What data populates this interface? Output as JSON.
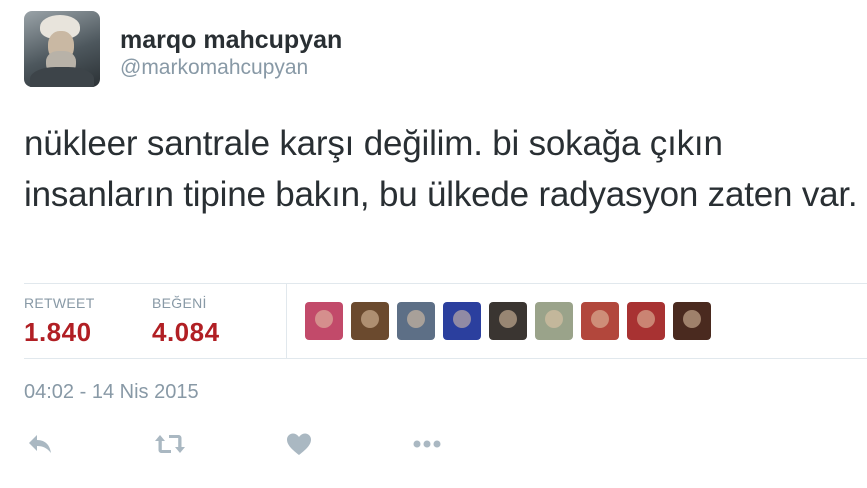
{
  "user": {
    "display_name": "marqo mahcupyan",
    "handle": "@markomahcupyan"
  },
  "tweet": {
    "text": "nükleer santrale karşı değilim. bi sokağa çıkın insanların tipine bakın, bu ülkede radyasyon zaten var.",
    "timestamp": "04:02 - 14 Nis 2015"
  },
  "stats": {
    "retweet_label": "RETWEET",
    "retweet_count": "1.840",
    "like_label": "BEĞENİ",
    "like_count": "4.084"
  },
  "likers": [
    {
      "name": "liker-avatar-1",
      "color": "#c24a6a"
    },
    {
      "name": "liker-avatar-2",
      "color": "#6b4a2e"
    },
    {
      "name": "liker-avatar-3",
      "color": "#5d6f86"
    },
    {
      "name": "liker-avatar-4",
      "color": "#2b3f9e"
    },
    {
      "name": "liker-avatar-5",
      "color": "#3a3531"
    },
    {
      "name": "liker-avatar-6",
      "color": "#9aa38a"
    },
    {
      "name": "liker-avatar-7",
      "color": "#b2473c"
    },
    {
      "name": "liker-avatar-8",
      "color": "#a83232"
    },
    {
      "name": "liker-avatar-9",
      "color": "#4a2a1f"
    }
  ],
  "actions": [
    {
      "name": "reply-icon"
    },
    {
      "name": "retweet-icon"
    },
    {
      "name": "heart-icon"
    },
    {
      "name": "more-icon"
    }
  ],
  "colors": {
    "accent_count": "#b11f24",
    "muted": "#8899a6",
    "icon": "#aab8c2",
    "divider": "#e1e8ed"
  }
}
